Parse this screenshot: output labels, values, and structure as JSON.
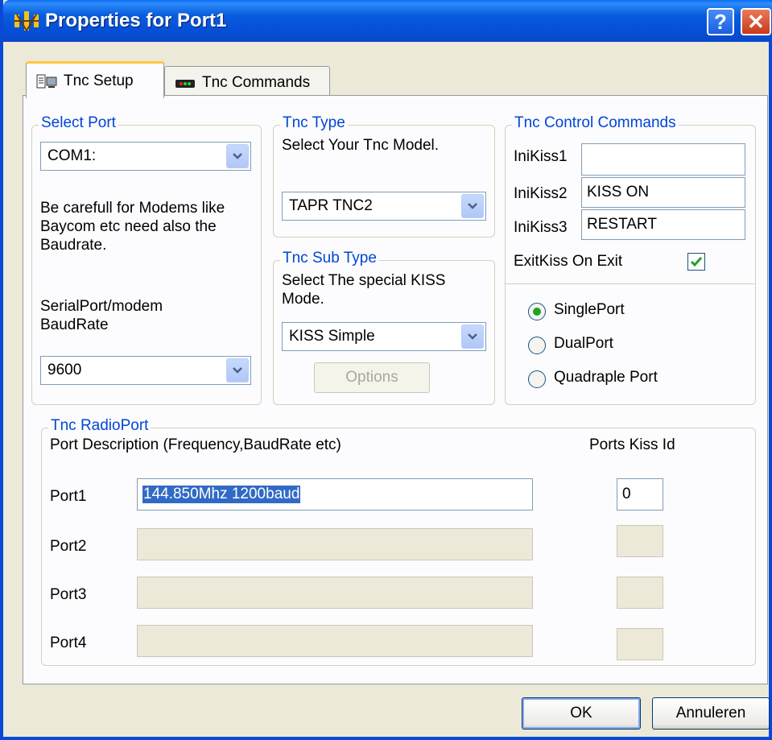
{
  "window": {
    "title": "Properties for Port1",
    "help_label": "?",
    "close_label": "✕"
  },
  "tabs": [
    {
      "label": "Tnc Setup",
      "active": true,
      "icon": "setup-icon"
    },
    {
      "label": "Tnc Commands",
      "active": false,
      "icon": "modem-icon"
    }
  ],
  "select_port": {
    "legend": "Select Port",
    "com_value": "COM1:",
    "note": "Be carefull for Modems like Baycom etc need also the Baudrate.",
    "baud_label": "SerialPort/modem BaudRate",
    "baud_value": "9600"
  },
  "tnc_type": {
    "legend": "Tnc Type",
    "hint": "Select Your Tnc Model.",
    "value": "TAPR TNC2"
  },
  "tnc_sub_type": {
    "legend": "Tnc Sub Type",
    "hint": "Select The special KISS Mode.",
    "value": "KISS Simple",
    "options_label": "Options"
  },
  "tnc_control": {
    "legend": "Tnc Control Commands",
    "inikiss1_label": "IniKiss1",
    "inikiss1_value": "",
    "inikiss2_label": "IniKiss2",
    "inikiss2_value": "KISS ON",
    "inikiss3_label": "IniKiss3",
    "inikiss3_value": "RESTART",
    "exitkiss_label": "ExitKiss On Exit",
    "exitkiss_checked": true,
    "port_modes": [
      {
        "label": "SinglePort",
        "selected": true
      },
      {
        "label": "DualPort",
        "selected": false
      },
      {
        "label": "Quadraple Port",
        "selected": false
      }
    ]
  },
  "radio_port": {
    "legend": "Tnc RadioPort",
    "desc_header": "Port Description (Frequency,BaudRate etc)",
    "kiss_header": "Ports Kiss Id",
    "ports": [
      {
        "label": "Port1",
        "description": "144.850Mhz 1200baud",
        "kiss_id": "0",
        "enabled": true
      },
      {
        "label": "Port2",
        "description": "",
        "kiss_id": "",
        "enabled": false
      },
      {
        "label": "Port3",
        "description": "",
        "kiss_id": "",
        "enabled": false
      },
      {
        "label": "Port4",
        "description": "",
        "kiss_id": "",
        "enabled": false
      }
    ]
  },
  "footer": {
    "ok_label": "OK",
    "cancel_label": "Annuleren"
  },
  "colors": {
    "accent": "#0046d5",
    "titlebar": "#0450d8",
    "tab_highlight": "#ffc73c",
    "check_green": "#21a121"
  }
}
